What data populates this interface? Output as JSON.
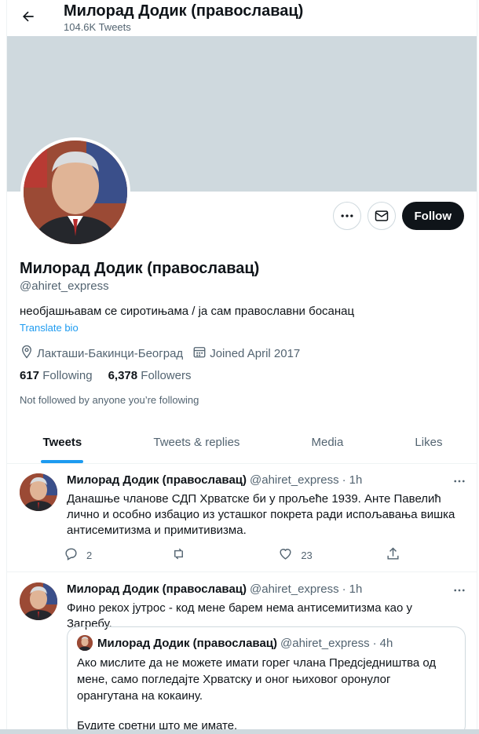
{
  "header": {
    "title": "Милорад Додик (православац)",
    "tweet_count": "104.6K Tweets"
  },
  "profile": {
    "name": "Милорад Додик (православац)",
    "handle": "@ahiret_express",
    "bio": "необјашњавам се сиротињама / ја сам православни босанац",
    "translate_label": "Translate bio",
    "location": "Лакташи-Бакинци-Београд",
    "joined": "Joined April 2017",
    "following_count": "617",
    "following_label": "Following",
    "followers_count": "6,378",
    "followers_label": "Followers",
    "not_followed": "Not followed by anyone you’re following",
    "follow_button": "Follow"
  },
  "tabs": [
    {
      "label": "Tweets",
      "active": true
    },
    {
      "label": "Tweets & replies",
      "active": false
    },
    {
      "label": "Media",
      "active": false
    },
    {
      "label": "Likes",
      "active": false
    }
  ],
  "tweets": [
    {
      "name": "Милорад Додик (православац)",
      "handle": "@ahiret_express",
      "sep": "·",
      "time": "1h",
      "text": "Данашње чланове СДП Хрватске би у прољеће 1939. Анте Павелић лично и особно избацио из усташког покрета ради испољавања вишка антисемитизма и примитивизма.",
      "replies": "2",
      "retweets": "",
      "likes": "23"
    },
    {
      "name": "Милорад Додик (православац)",
      "handle": "@ahiret_express",
      "sep": "·",
      "time": "1h",
      "text": "Фино рекох јутрос - код мене барем нема антисемитизма као у Загребу.",
      "quote": {
        "name": "Милорад Додик (православац)",
        "handle": "@ahiret_express",
        "sep": "·",
        "time": "4h",
        "text1": "Ако мислите да не можете имати горег члана Предсједништва од мене, само погледајте Хрватску и оног њиховог оронулог орангутана на кокаину.",
        "text2": "Будите сретни што ме имате."
      }
    }
  ],
  "colors": {
    "accent": "#1d9bf0",
    "text": "#0f1419",
    "secondary": "#536471",
    "banner": "#cfd9de"
  }
}
